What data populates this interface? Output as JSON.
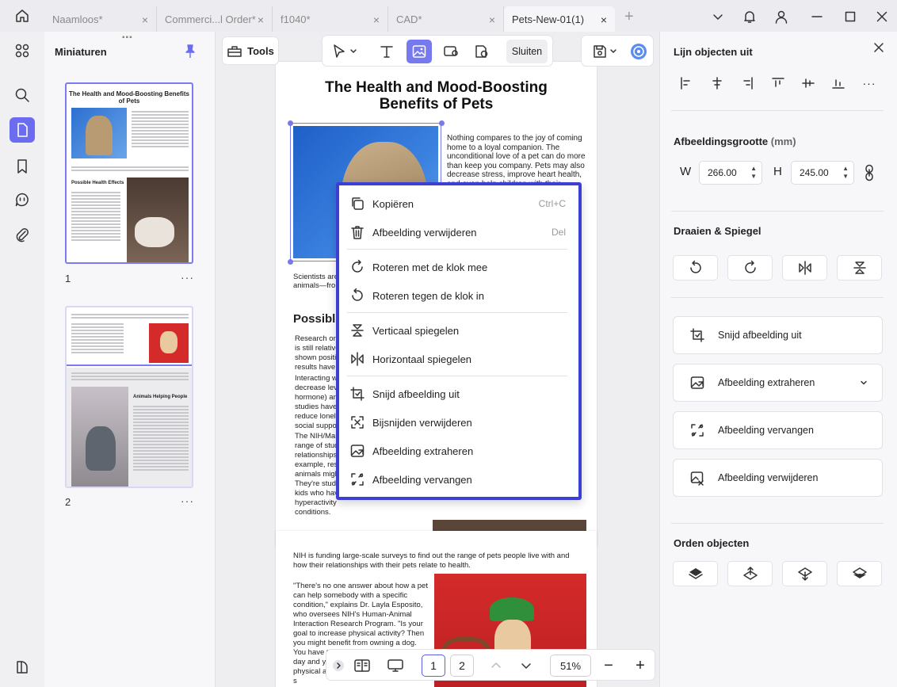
{
  "tabs": [
    {
      "label": "Naamloos*",
      "active": false
    },
    {
      "label": "Commerci...l Order*",
      "active": false
    },
    {
      "label": "f1040*",
      "active": false
    },
    {
      "label": "CAD*",
      "active": false
    },
    {
      "label": "Pets-New-01(1)",
      "active": true
    }
  ],
  "tab_close": "×",
  "tab_add": "+",
  "thumbnails": {
    "title": "Miniaturen",
    "pages": [
      {
        "number": "1",
        "heading": "The Health and Mood-Boosting Benefits of Pets",
        "section": "Possible Health Effects"
      },
      {
        "number": "2",
        "section": "Animals Helping People"
      }
    ],
    "more": "···"
  },
  "toolbar": {
    "tools_label": "Tools",
    "close_label": "Sluiten"
  },
  "document": {
    "page1": {
      "title_line1": "The Health and Mood-Boosting",
      "title_line2": "Benefits of Pets",
      "intro": "Nothing compares to the joy of coming home to a loyal companion. The unconditional love of a pet can do more than keep you company. Pets may also decrease stress, improve heart health, and even help children with their emotional and social skills.",
      "scientists": "Scientists are",
      "animals": "animals—from",
      "possible": "Possibl",
      "research": "Research on\nis still relative\nshown positiv\nresults have be",
      "interacting": "Interacting wi\ndecrease leve\nhormone) and\nstudies have f\nreduce loneli\nsocial suppor",
      "nih": "The NIH/Mar\nrange of stud\nrelationships\nexample, rese\nanimals migh\nThey're stud\nkids who hav\nhyperactivity\nconditions."
    },
    "page2": {
      "intro": "NIH is funding large-scale surveys to find out the range of pets people live with and how their relationships with their pets relate to health.",
      "quote": "\"There's no one answer about how a pet can help somebody with a specific condition,\" explains Dr. Layla Esposito, who oversees NIH's Human-Animal Interaction Research Program. \"Is your goal to increase physical activity? Then you might benefit from owning a dog. You have to walk a dog several times a day and you're going to increase your physical activity. If your goal is reducing s\nswim can re\nthere's no o"
    }
  },
  "context_menu": {
    "items": [
      {
        "label": "Kopiëren",
        "shortcut": "Ctrl+C"
      },
      {
        "label": "Afbeelding verwijderen",
        "shortcut": "Del"
      },
      {
        "label": "Roteren met de klok mee",
        "shortcut": ""
      },
      {
        "label": "Roteren tegen de klok in",
        "shortcut": ""
      },
      {
        "label": "Verticaal spiegelen",
        "shortcut": ""
      },
      {
        "label": "Horizontaal spiegelen",
        "shortcut": ""
      },
      {
        "label": "Snijd afbeelding uit",
        "shortcut": ""
      },
      {
        "label": "Bijsnijden verwijderen",
        "shortcut": ""
      },
      {
        "label": "Afbeelding extraheren",
        "shortcut": ""
      },
      {
        "label": "Afbeelding vervangen",
        "shortcut": ""
      }
    ]
  },
  "right_panel": {
    "align_title": "Lijn objecten uit",
    "size_title": "Afbeeldingsgrootte",
    "size_unit": "(mm)",
    "width_label": "W",
    "width_value": "266.00",
    "height_label": "H",
    "height_value": "245.00",
    "rotate_title": "Draaien & Spiegel",
    "actions": [
      {
        "label": "Snijd afbeelding uit"
      },
      {
        "label": "Afbeelding extraheren"
      },
      {
        "label": "Afbeelding vervangen"
      },
      {
        "label": "Afbeelding verwijderen"
      }
    ],
    "order_title": "Orden objecten",
    "more": "···"
  },
  "bottom_bar": {
    "page_1": "1",
    "page_2": "2",
    "zoom": "51%",
    "minus": "−",
    "plus": "+"
  },
  "colors": {
    "accent": "#6b6cf0",
    "menu_border": "#3b3fd4"
  }
}
